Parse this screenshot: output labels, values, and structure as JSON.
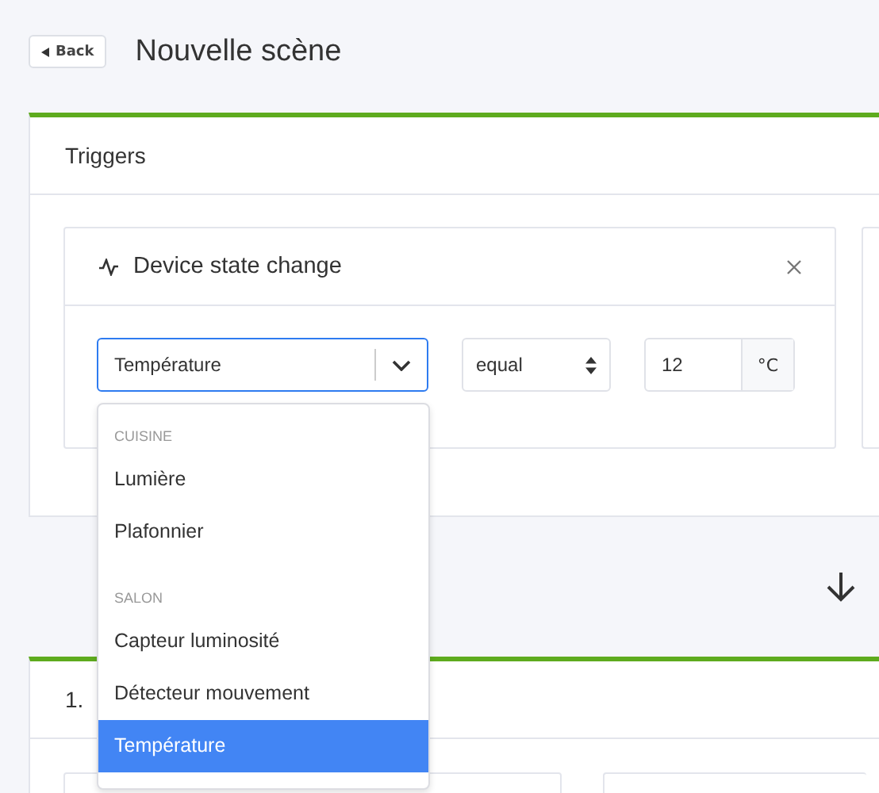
{
  "header": {
    "back_button": "Back",
    "title": "Nouvelle scène"
  },
  "triggers_panel": {
    "title": "Triggers",
    "card": {
      "title": "Device state change",
      "device_select": {
        "value": "Température",
        "expanded": true,
        "options": [
          {
            "kind": "group",
            "label": "CUISINE"
          },
          {
            "kind": "option",
            "label": "Lumière",
            "selected": false
          },
          {
            "kind": "option",
            "label": "Plafonnier",
            "selected": false
          },
          {
            "kind": "group",
            "label": "SALON"
          },
          {
            "kind": "option",
            "label": "Capteur luminosité",
            "selected": false
          },
          {
            "kind": "option",
            "label": "Détecteur mouvement",
            "selected": false
          },
          {
            "kind": "option",
            "label": "Température",
            "selected": true
          }
        ]
      },
      "operator_select": {
        "value": "equal"
      },
      "value_field": {
        "value": "12",
        "unit": "°C"
      }
    }
  },
  "actions_panel": {
    "title": "1."
  }
}
